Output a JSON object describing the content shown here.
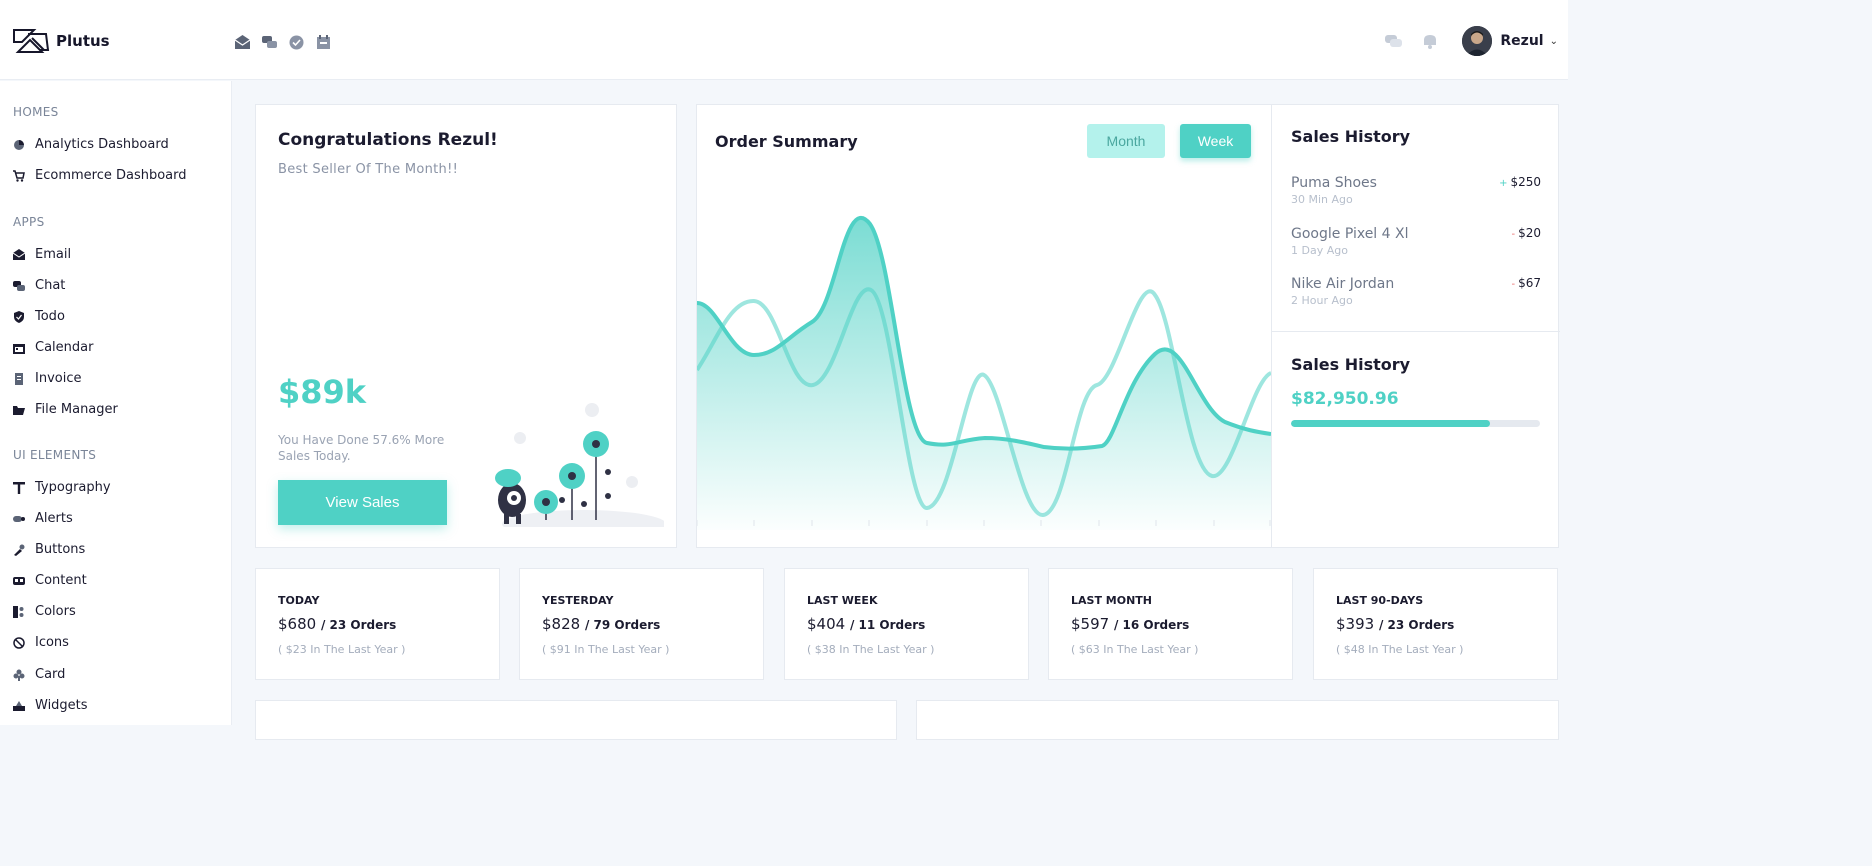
{
  "brand": {
    "name": "Plutus"
  },
  "header": {
    "quick_icons": [
      "email-icon",
      "chat-icon",
      "todo-icon",
      "calendar-icon"
    ],
    "right_icons": [
      "messages-icon",
      "notifications-icon"
    ],
    "user_name": "Rezul"
  },
  "sidebar": {
    "sections": [
      {
        "title": "HOMES",
        "items": [
          {
            "label": "Analytics Dashboard",
            "icon": "pie-chart-icon"
          },
          {
            "label": "Ecommerce Dashboard",
            "icon": "cart-icon"
          }
        ]
      },
      {
        "title": "APPS",
        "items": [
          {
            "label": "Email",
            "icon": "email-icon"
          },
          {
            "label": "Chat",
            "icon": "chat-icon"
          },
          {
            "label": "Todo",
            "icon": "shield-check-icon"
          },
          {
            "label": "Calendar",
            "icon": "calendar-icon"
          },
          {
            "label": "Invoice",
            "icon": "document-icon"
          },
          {
            "label": "File Manager",
            "icon": "folder-icon"
          }
        ]
      },
      {
        "title": "UI ELEMENTS",
        "items": [
          {
            "label": "Typography",
            "icon": "typography-icon"
          },
          {
            "label": "Alerts",
            "icon": "alert-icon"
          },
          {
            "label": "Buttons",
            "icon": "buttons-icon"
          },
          {
            "label": "Content",
            "icon": "content-icon"
          },
          {
            "label": "Colors",
            "icon": "colors-icon"
          },
          {
            "label": "Icons",
            "icon": "icons-icon"
          },
          {
            "label": "Card",
            "icon": "card-icon"
          },
          {
            "label": "Widgets",
            "icon": "widgets-icon"
          }
        ]
      }
    ]
  },
  "congrats": {
    "title": "Congratulations Rezul!",
    "subtitle": "Best Seller Of The Month!!",
    "amount": "$89k",
    "description": "You Have Done 57.6% More Sales Today.",
    "button_label": "View Sales"
  },
  "order_summary": {
    "title": "Order Summary",
    "toggle_month": "Month",
    "toggle_week": "Week"
  },
  "sales_history": {
    "title": "Sales History",
    "items": [
      {
        "name": "Puma Shoes",
        "time": "30 Min Ago",
        "sign": "+",
        "value": "$250"
      },
      {
        "name": "Google Pixel 4 Xl",
        "time": "1 Day Ago",
        "sign": "-",
        "value": "$20"
      },
      {
        "name": "Nike Air Jordan",
        "time": "2 Hour Ago",
        "sign": "-",
        "value": "$67"
      }
    ],
    "title2": "Sales History",
    "total": "$82,950.96",
    "progress": 0.8
  },
  "stats": [
    {
      "label": "TODAY",
      "amount": "$680",
      "orders": "/ 23 Orders",
      "last_year": "( $23 In The Last Year )"
    },
    {
      "label": "YESTERDAY",
      "amount": "$828",
      "orders": "/ 79 Orders",
      "last_year": "( $91 In The Last Year )"
    },
    {
      "label": "LAST WEEK",
      "amount": "$404",
      "orders": "/ 11 Orders",
      "last_year": "( $38 In The Last Year )"
    },
    {
      "label": "LAST MONTH",
      "amount": "$597",
      "orders": "/ 16 Orders",
      "last_year": "( $63 In The Last Year )"
    },
    {
      "label": "LAST 90-DAYS",
      "amount": "$393",
      "orders": "/ 23 Orders",
      "last_year": "( $48 In The Last Year )"
    }
  ],
  "colors": {
    "accent": "#4fd1c5",
    "accent_light": "#b4f2ec",
    "text": "#1b1b2f",
    "muted": "#8a93a5"
  }
}
